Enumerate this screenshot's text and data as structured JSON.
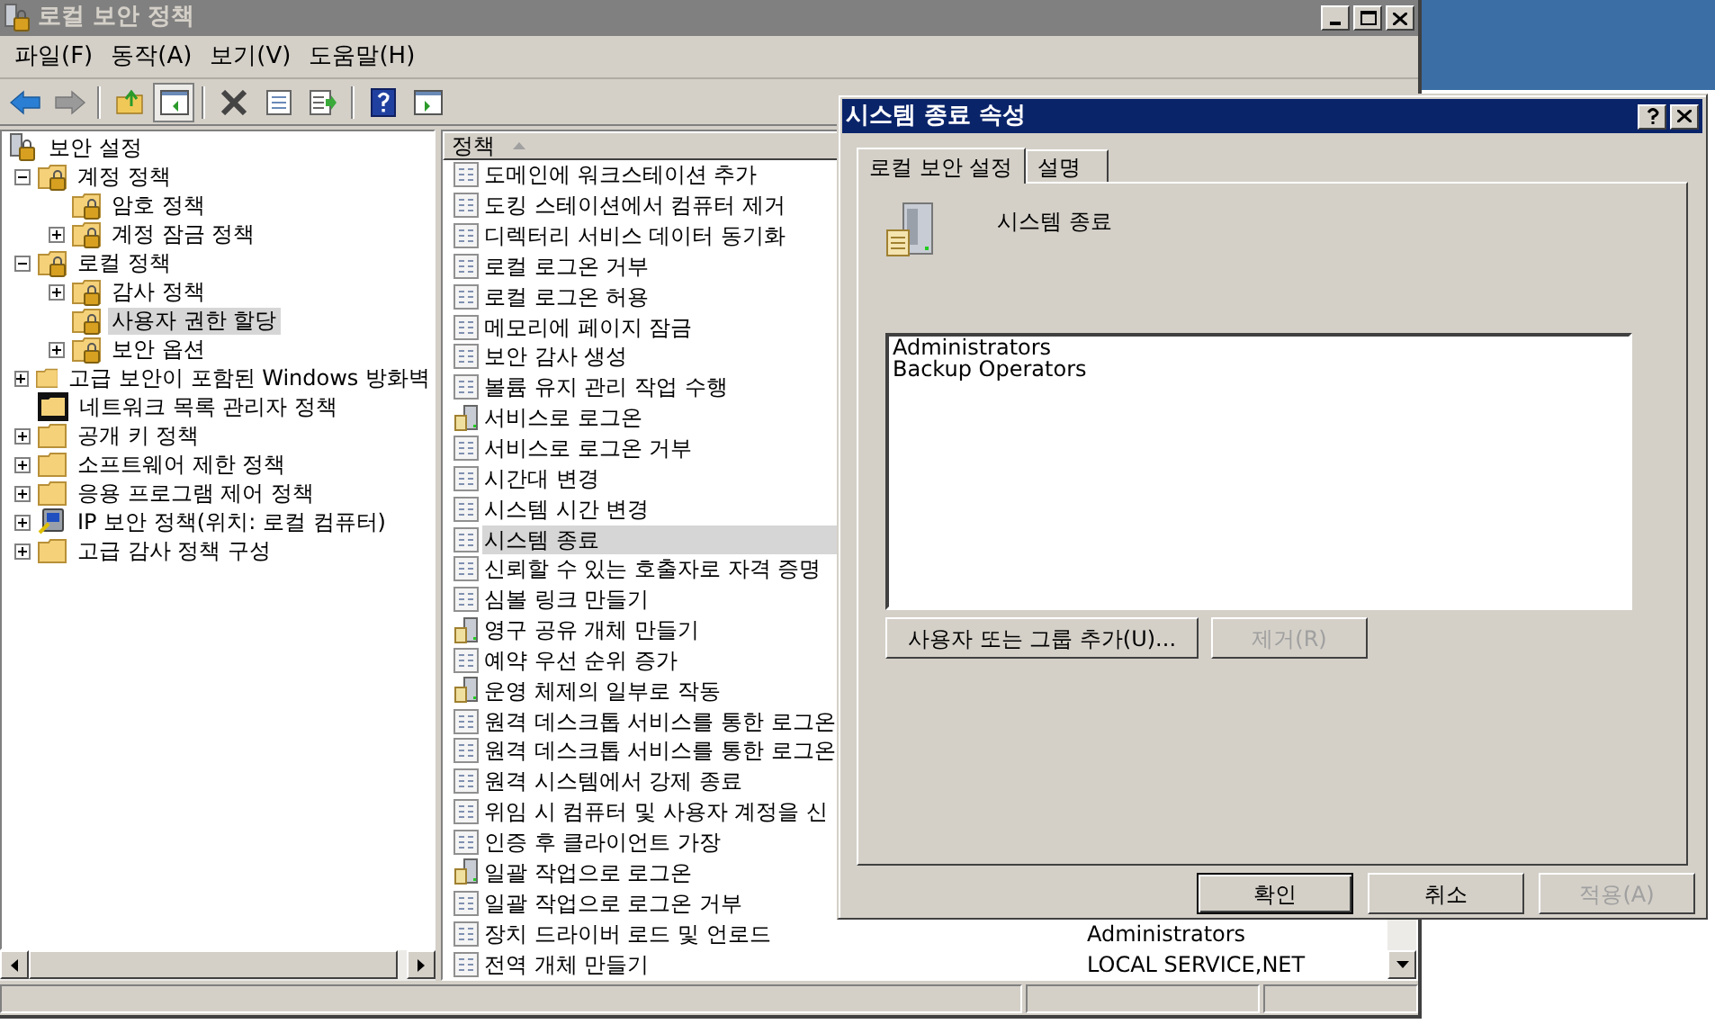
{
  "window": {
    "title": "로컬 보안 정책"
  },
  "menu": [
    "파일(F)",
    "동작(A)",
    "보기(V)",
    "도움말(H)"
  ],
  "toolbar": [
    {
      "kind": "back",
      "disabled": false,
      "pressed": false
    },
    {
      "kind": "forward",
      "disabled": true,
      "pressed": false
    },
    {
      "kind": "sep"
    },
    {
      "kind": "up",
      "disabled": false,
      "pressed": false
    },
    {
      "kind": "tree",
      "disabled": false,
      "pressed": true
    },
    {
      "kind": "sep"
    },
    {
      "kind": "delete",
      "disabled": false,
      "pressed": false
    },
    {
      "kind": "properties",
      "disabled": false,
      "pressed": false
    },
    {
      "kind": "export",
      "disabled": false,
      "pressed": false
    },
    {
      "kind": "sep"
    },
    {
      "kind": "help",
      "disabled": false,
      "pressed": false
    },
    {
      "kind": "view",
      "disabled": false,
      "pressed": false
    }
  ],
  "tree": [
    {
      "label": "보안 설정",
      "kind": "root",
      "selected": false,
      "children": [
        {
          "label": "계정 정책",
          "kind": "lock",
          "expanded": true,
          "selected": false,
          "children": [
            {
              "label": "암호 정책",
              "kind": "lock",
              "selected": false
            },
            {
              "label": "계정 잠금 정책",
              "kind": "lock",
              "expanded": false,
              "selected": false
            }
          ]
        },
        {
          "label": "로컬 정책",
          "kind": "lock",
          "expanded": true,
          "selected": false,
          "children": [
            {
              "label": "감사 정책",
              "kind": "lock",
              "expanded": false,
              "selected": false
            },
            {
              "label": "사용자 권한 할당",
              "kind": "lock",
              "selected": true
            },
            {
              "label": "보안 옵션",
              "kind": "lock",
              "expanded": false,
              "selected": false
            }
          ]
        },
        {
          "label": "고급 보안이 포함된 Windows 방화벽",
          "kind": "folder",
          "expanded": false,
          "selected": false
        },
        {
          "label": "네트워크 목록 관리자 정책",
          "kind": "dark",
          "selected": false
        },
        {
          "label": "공개 키 정책",
          "kind": "folder",
          "expanded": false,
          "selected": false
        },
        {
          "label": "소프트웨어 제한 정책",
          "kind": "folder",
          "expanded": false,
          "selected": false
        },
        {
          "label": "응용 프로그램 제어 정책",
          "kind": "folder",
          "expanded": false,
          "selected": false
        },
        {
          "label": "IP 보안 정책(위치: 로컬 컴퓨터)",
          "kind": "ip",
          "expanded": false,
          "selected": false
        },
        {
          "label": "고급 감사 정책 구성",
          "kind": "folder",
          "expanded": false,
          "selected": false
        }
      ]
    }
  ],
  "list": {
    "columns": [
      {
        "label": "정책",
        "sorted": true
      }
    ],
    "rows": [
      {
        "policy": "도메인에 워크스테이션 추가",
        "kind": "doc",
        "selected": false
      },
      {
        "policy": "도킹 스테이션에서 컴퓨터 제거",
        "kind": "doc",
        "selected": false
      },
      {
        "policy": "디렉터리 서비스 데이터 동기화",
        "kind": "doc",
        "selected": false
      },
      {
        "policy": "로컬 로그온 거부",
        "kind": "doc",
        "selected": false
      },
      {
        "policy": "로컬 로그온 허용",
        "kind": "doc",
        "selected": false
      },
      {
        "policy": "메모리에 페이지 잠금",
        "kind": "doc",
        "selected": false
      },
      {
        "policy": "보안 감사 생성",
        "kind": "doc",
        "selected": false
      },
      {
        "policy": "볼륨 유지 관리 작업 수행",
        "kind": "doc",
        "selected": false
      },
      {
        "policy": "서비스로 로그온",
        "kind": "server",
        "selected": false
      },
      {
        "policy": "서비스로 로그온 거부",
        "kind": "doc",
        "selected": false
      },
      {
        "policy": "시간대 변경",
        "kind": "doc",
        "selected": false
      },
      {
        "policy": "시스템 시간 변경",
        "kind": "doc",
        "selected": false
      },
      {
        "policy": "시스템 종료",
        "kind": "doc",
        "selected": true
      },
      {
        "policy": "신뢰할 수 있는 호출자로 자격 증명",
        "kind": "doc",
        "selected": false
      },
      {
        "policy": "심볼 링크 만들기",
        "kind": "doc",
        "selected": false
      },
      {
        "policy": "영구 공유 개체 만들기",
        "kind": "server",
        "selected": false
      },
      {
        "policy": "예약 우선 순위 증가",
        "kind": "doc",
        "selected": false
      },
      {
        "policy": "운영 체제의 일부로 작동",
        "kind": "server",
        "selected": false
      },
      {
        "policy": "원격 데스크톱 서비스를 통한 로그온",
        "kind": "doc",
        "selected": false
      },
      {
        "policy": "원격 데스크톱 서비스를 통한 로그온",
        "kind": "doc",
        "selected": false
      },
      {
        "policy": "원격 시스템에서 강제 종료",
        "kind": "doc",
        "selected": false
      },
      {
        "policy": "위임 시 컴퓨터 및 사용자 계정을 신",
        "kind": "doc",
        "selected": false
      },
      {
        "policy": "인증 후 클라이언트 가장",
        "kind": "doc",
        "selected": false
      },
      {
        "policy": "일괄 작업으로 로그온",
        "kind": "server",
        "selected": false
      },
      {
        "policy": "일괄 작업으로 로그온 거부",
        "kind": "doc",
        "selected": false
      },
      {
        "policy": "장치 드라이버 로드 및 언로드",
        "setting": "Administrators",
        "kind": "doc",
        "selected": false
      },
      {
        "policy": "전역 개체 만들기",
        "setting": "LOCAL SERVICE,NET",
        "kind": "doc",
        "selected": false
      }
    ]
  },
  "dialog": {
    "title": "시스템 종료 속성",
    "tabs": [
      {
        "label": "로컬 보안 설정",
        "selected": true
      },
      {
        "label": "설명",
        "selected": false
      }
    ],
    "policy_name": "시스템 종료",
    "members": [
      "Administrators",
      "Backup Operators"
    ],
    "add_button": {
      "label": "사용자 또는 그룹 추가(U)...",
      "disabled": false
    },
    "remove_button": {
      "label": "제거(R)",
      "disabled": true
    },
    "buttons": [
      {
        "label": "확인",
        "default": true,
        "disabled": false
      },
      {
        "label": "취소",
        "default": false,
        "disabled": false
      },
      {
        "label": "적용(A)",
        "default": false,
        "disabled": true
      }
    ]
  }
}
